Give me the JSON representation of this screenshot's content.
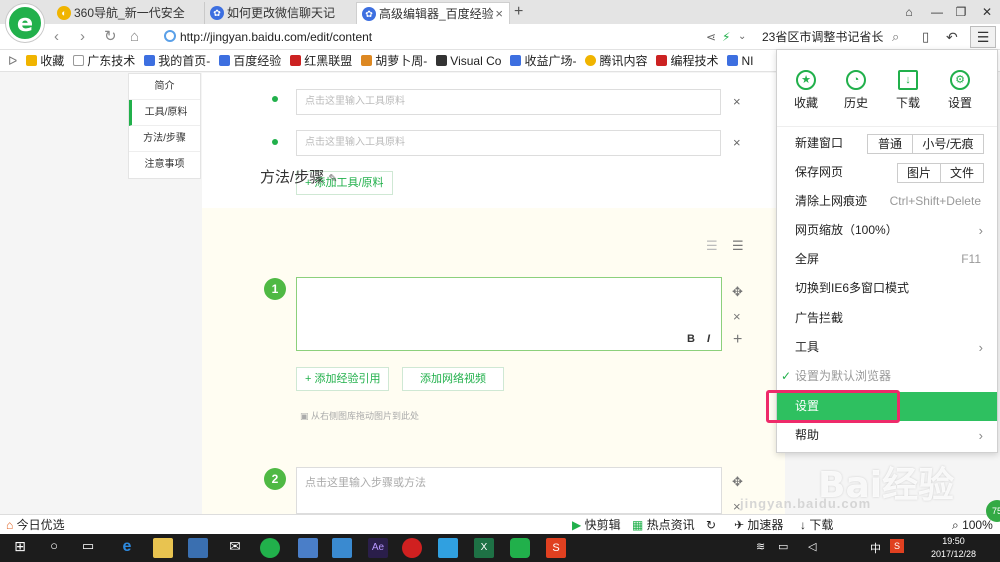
{
  "browser": {
    "tabs": [
      {
        "title": "360导航_新一代安全",
        "icon_color": "#f0b400"
      },
      {
        "title": "如何更改微信聊天记",
        "icon_color": "#3d6fe0"
      },
      {
        "title": "高级编辑器_百度经验",
        "icon_color": "#3d6fe0"
      }
    ],
    "new_tab": "+",
    "url": "http://jingyan.baidu.com/edit/content",
    "search_value": "23省区市调整书记省长",
    "menu_button": "☰"
  },
  "bookmarks": [
    {
      "label": "收藏",
      "color": "#f0b400"
    },
    {
      "label": "广东技术",
      "color": "#ffffff"
    },
    {
      "label": "我的首页-",
      "color": "#3d6fe0"
    },
    {
      "label": "百度经验",
      "color": "#3d6fe0"
    },
    {
      "label": "红黑联盟",
      "color": "#cc2222"
    },
    {
      "label": "胡萝卜周-",
      "color": "#dd8822"
    },
    {
      "label": "Visual Co",
      "color": "#333333"
    },
    {
      "label": "收益广场-",
      "color": "#3d6fe0"
    },
    {
      "label": "腾讯内容",
      "color": "#f0b400"
    },
    {
      "label": "编程技术",
      "color": "#cc2222"
    },
    {
      "label": "NI",
      "color": "#3d6fe0"
    }
  ],
  "sidenav": [
    "简介",
    "工具/原料",
    "方法/步骤",
    "注意事项"
  ],
  "editor": {
    "tool_placeholder": "点击这里输入工具原料",
    "add_tool": "+ 添加工具/原料",
    "steps_title": "方法/步骤",
    "step1_num": "1",
    "step2_num": "2",
    "bold": "B",
    "italic": "I",
    "add_reference": "+ 添加经验引用",
    "add_video": "添加网络视频",
    "drag_hint": "从右侧图库拖动图片到此处",
    "step_placeholder": "点击这里输入步骤或方法",
    "remove": "×",
    "move": "✥",
    "add": "+"
  },
  "menu": {
    "quick": [
      {
        "label": "收藏",
        "icon": "star-icon"
      },
      {
        "label": "历史",
        "icon": "clock-icon"
      },
      {
        "label": "下载",
        "icon": "download-icon"
      },
      {
        "label": "设置",
        "icon": "gear-icon"
      }
    ],
    "new_window": "新建窗口",
    "normal": "普通",
    "small_private": "小号/无痕",
    "save_page": "保存网页",
    "picture": "图片",
    "file": "文件",
    "clear_traces": "清除上网痕迹",
    "clear_shortcut": "Ctrl+Shift+Delete",
    "zoom": "网页缩放（100%）",
    "fullscreen": "全屏",
    "fullscreen_key": "F11",
    "ie6_mode": "切换到IE6多窗口模式",
    "adblock": "广告拦截",
    "tools": "工具",
    "default_browser": "设置为默认浏览器",
    "settings": "设置",
    "help": "帮助"
  },
  "statusbar": {
    "today": "今日优选",
    "quick_clip": "快剪辑",
    "hot_news": "热点资讯",
    "accelerator": "加速器",
    "download": "下载",
    "zoom": "100%"
  },
  "watermark": {
    "brand": "Bai经验",
    "url": "jingyan.baidu.com"
  },
  "taskbar": {
    "time": "19:50",
    "date": "2017/12/28",
    "ime": "中",
    "badge": "75"
  }
}
